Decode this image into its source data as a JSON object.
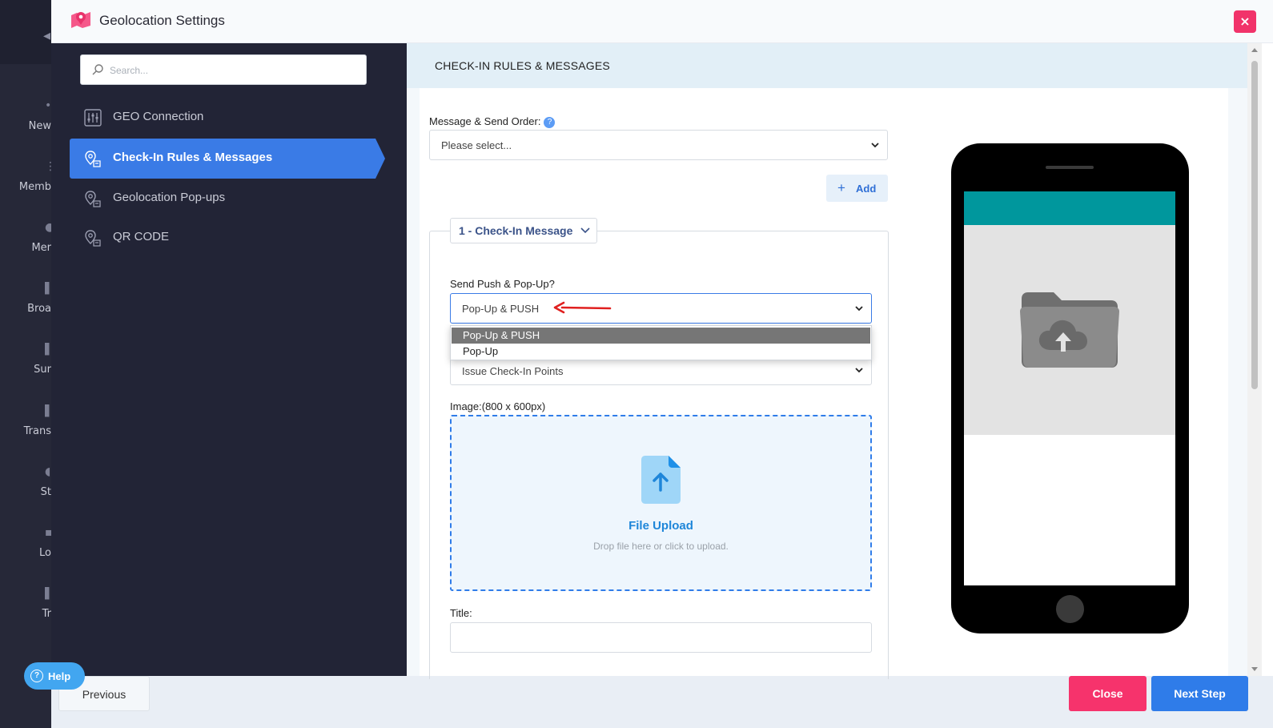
{
  "background_nav": {
    "items": [
      {
        "label": "New"
      },
      {
        "label": "Memb"
      },
      {
        "label": "Mer"
      },
      {
        "label": "Broa"
      },
      {
        "label": "Sur"
      },
      {
        "label": "Trans"
      },
      {
        "label": "St"
      },
      {
        "label": "Lo"
      },
      {
        "label": "Tr"
      }
    ]
  },
  "header": {
    "title": "Geolocation Settings",
    "close_symbol": "×"
  },
  "sidebar": {
    "search_placeholder": "Search...",
    "items": [
      {
        "label": "GEO Connection",
        "icon": "sliders-icon",
        "active": false
      },
      {
        "label": "Check-In Rules & Messages",
        "icon": "map-pin-icon",
        "active": true
      },
      {
        "label": "Geolocation Pop-ups",
        "icon": "map-pin-icon",
        "active": false
      },
      {
        "label": "QR CODE",
        "icon": "map-pin-icon",
        "active": false
      }
    ]
  },
  "section": {
    "title": "CHECK-IN RULES & MESSAGES"
  },
  "form": {
    "message_order_label": "Message & Send Order:",
    "message_order_help": "?",
    "message_order_value": "Please select...",
    "add_label": "Add",
    "add_symbol": "+",
    "tab_label": "1 - Check-In Message",
    "send_push_label": "Send Push & Pop-Up?",
    "send_push_value": "Pop-Up & PUSH",
    "send_push_options": [
      {
        "label": "Pop-Up & PUSH",
        "selected": true
      },
      {
        "label": "Pop-Up",
        "selected": false
      }
    ],
    "points_value": "Issue Check-In Points",
    "image_label": "Image:(800 x 600px)",
    "upload_title": "File Upload",
    "upload_subtitle": "Drop file here or click to upload.",
    "title_label": "Title:",
    "title_value": ""
  },
  "footer": {
    "previous_label": "Previous",
    "close_label": "Close",
    "next_label": "Next Step"
  },
  "help": {
    "label": "Help",
    "symbol": "?"
  },
  "colors": {
    "accent_blue": "#2f7ce9",
    "close_pink": "#f6336c",
    "sidebar_bg": "#222436",
    "phone_header_teal": "#00979d",
    "annotation_arrow": "#e0201f"
  }
}
